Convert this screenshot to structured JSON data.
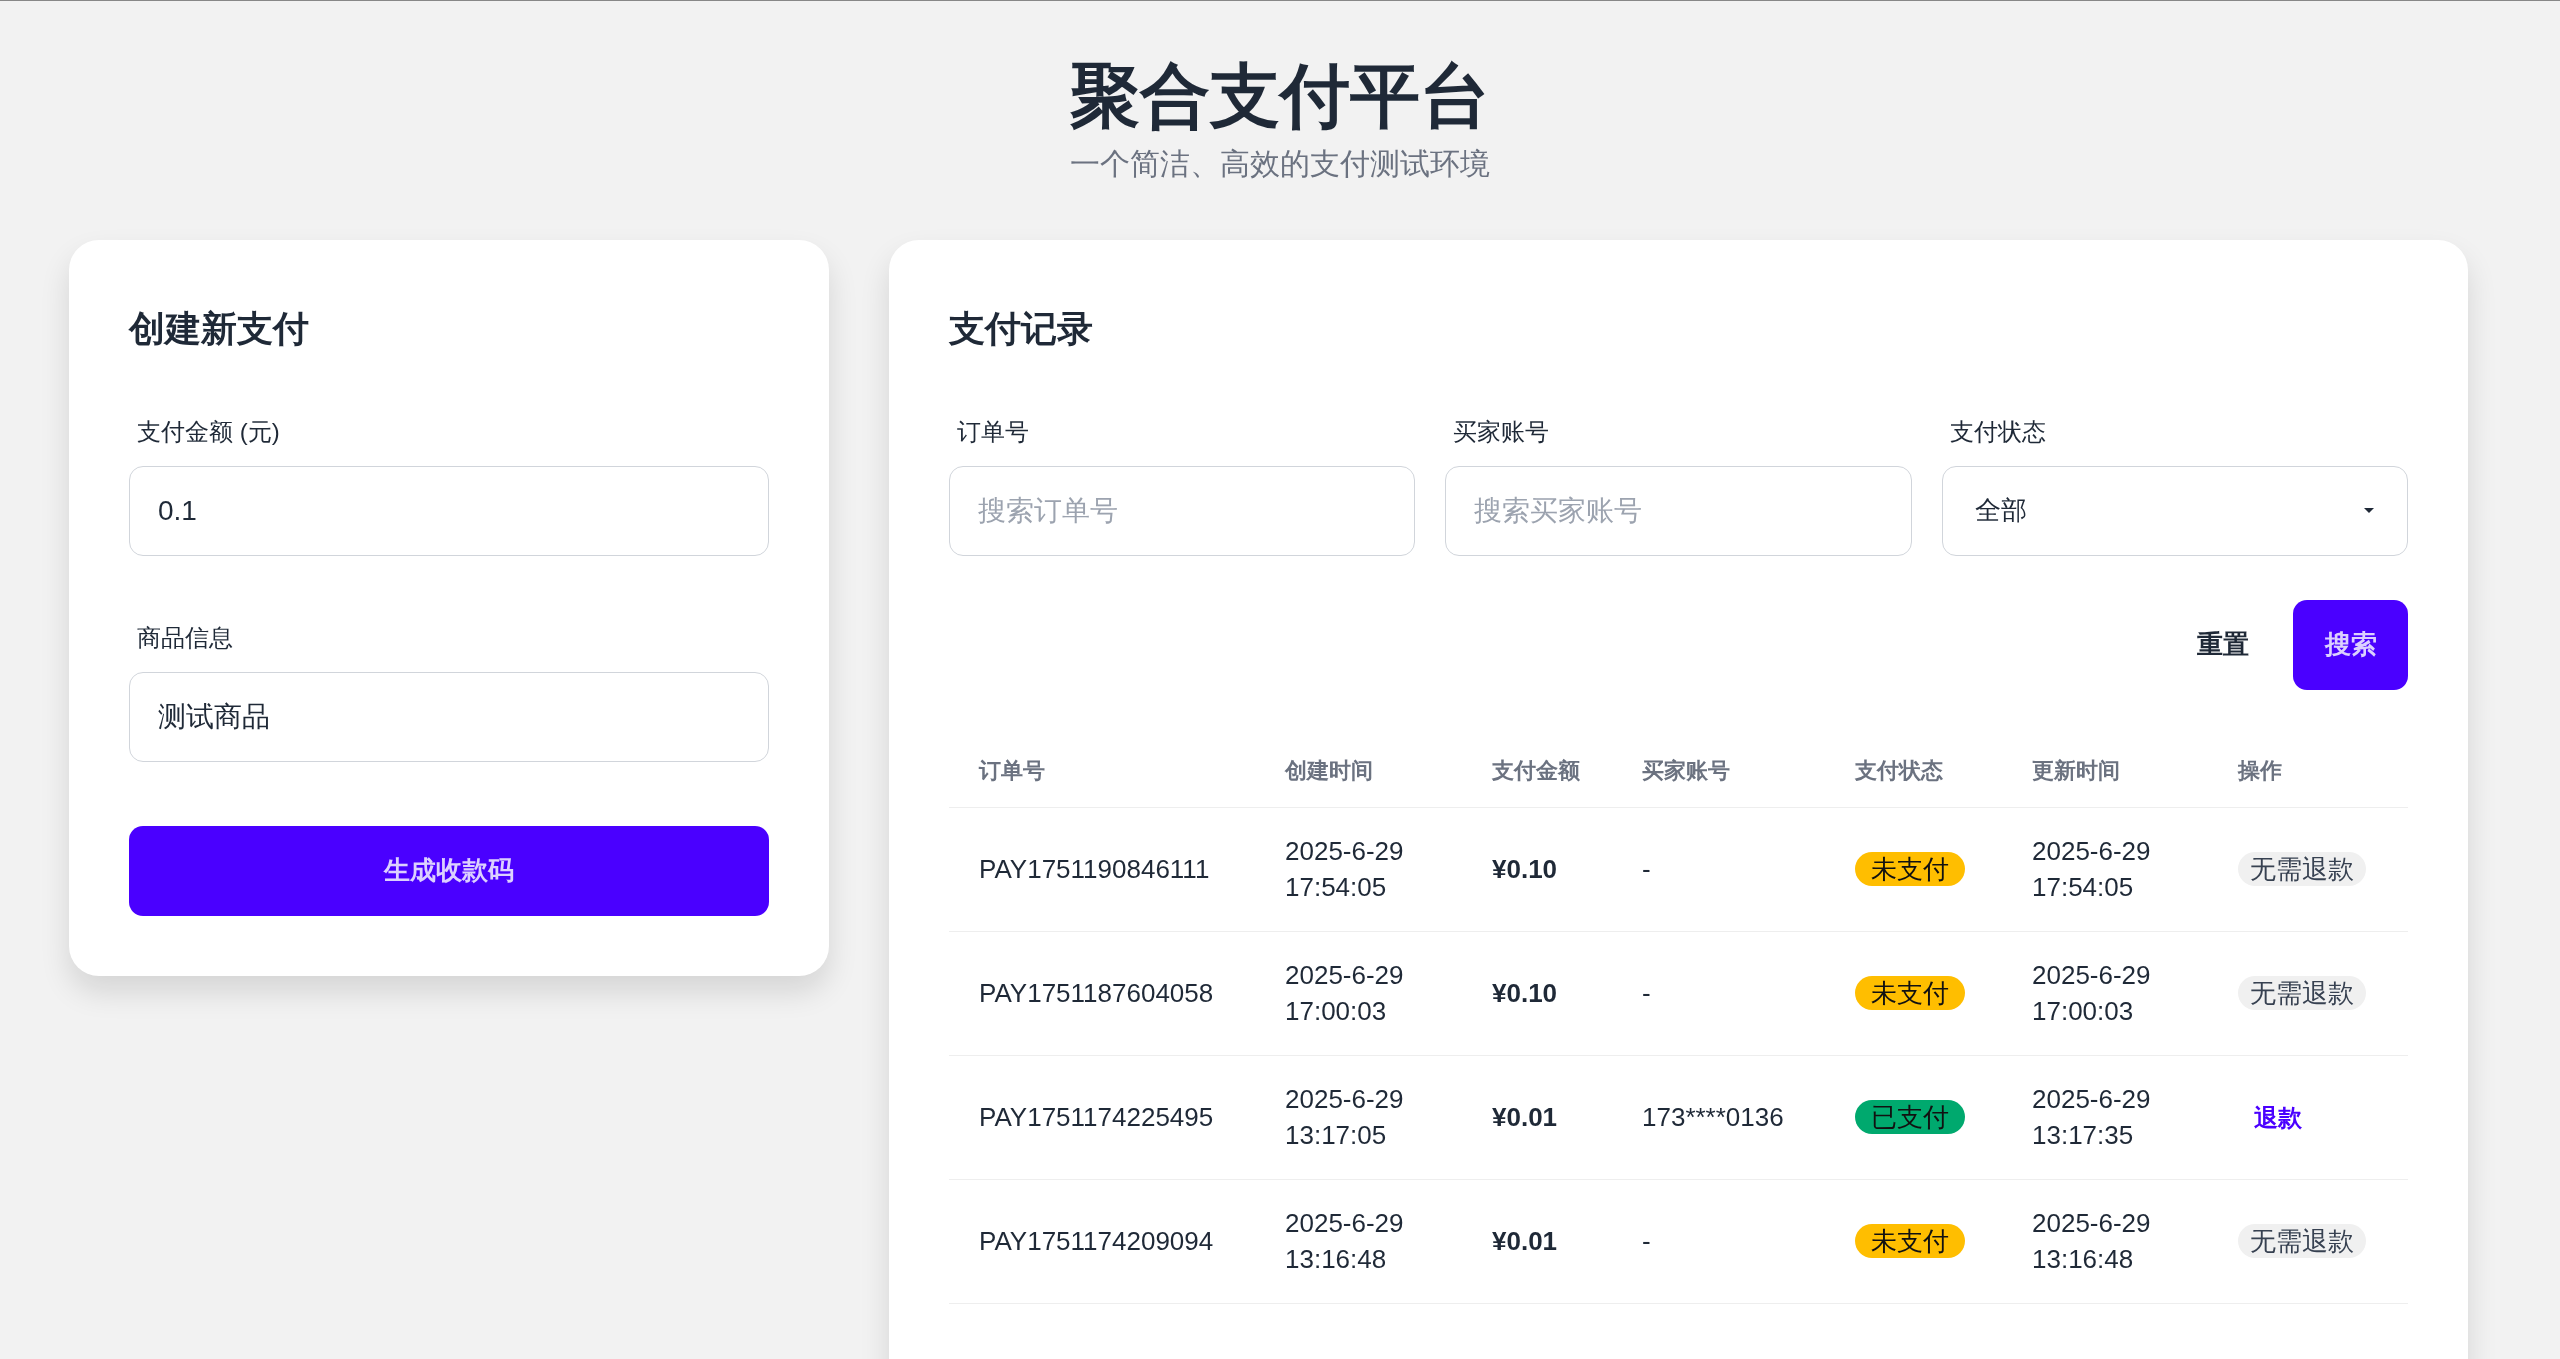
{
  "header": {
    "title": "聚合支付平台",
    "subtitle": "一个简洁、高效的支付测试环境"
  },
  "create_form": {
    "title": "创建新支付",
    "fields": [
      {
        "label": "支付金额 (元)",
        "value": "0.1"
      },
      {
        "label": "商品信息",
        "value": "测试商品"
      }
    ],
    "submit": "生成收款码"
  },
  "records": {
    "title": "支付记录",
    "filters": [
      {
        "kind": "input",
        "label": "订单号",
        "placeholder": "搜索订单号"
      },
      {
        "kind": "input",
        "label": "买家账号",
        "placeholder": "搜索买家账号"
      },
      {
        "kind": "select",
        "label": "支付状态",
        "value": "全部"
      }
    ],
    "reset": "重置",
    "search": "搜索",
    "table": {
      "columns": [
        "订单号",
        "创建时间",
        "支付金额",
        "买家账号",
        "支付状态",
        "更新时间",
        "操作"
      ],
      "rows": [
        {
          "order": "PAY1751190846111",
          "created": [
            "2025-6-29",
            "17:54:05"
          ],
          "amount": "¥0.10",
          "buyer": "-",
          "status": {
            "label": "未支付",
            "color": "#ffbe00"
          },
          "updated": [
            "2025-6-29",
            "17:54:05"
          ],
          "action": {
            "kind": "tag",
            "label": "无需退款"
          }
        },
        {
          "order": "PAY1751187604058",
          "created": [
            "2025-6-29",
            "17:00:03"
          ],
          "amount": "¥0.10",
          "buyer": "-",
          "status": {
            "label": "未支付",
            "color": "#ffbe00"
          },
          "updated": [
            "2025-6-29",
            "17:00:03"
          ],
          "action": {
            "kind": "tag",
            "label": "无需退款"
          }
        },
        {
          "order": "PAY1751174225495",
          "created": [
            "2025-6-29",
            "13:17:05"
          ],
          "amount": "¥0.01",
          "buyer": "173****0136",
          "status": {
            "label": "已支付",
            "color": "#00a96e"
          },
          "updated": [
            "2025-6-29",
            "13:17:35"
          ],
          "action": {
            "kind": "link",
            "label": "退款"
          }
        },
        {
          "order": "PAY1751174209094",
          "created": [
            "2025-6-29",
            "13:16:48"
          ],
          "amount": "¥0.01",
          "buyer": "-",
          "status": {
            "label": "未支付",
            "color": "#ffbe00"
          },
          "updated": [
            "2025-6-29",
            "13:16:48"
          ],
          "action": {
            "kind": "tag",
            "label": "无需退款"
          }
        }
      ]
    }
  }
}
